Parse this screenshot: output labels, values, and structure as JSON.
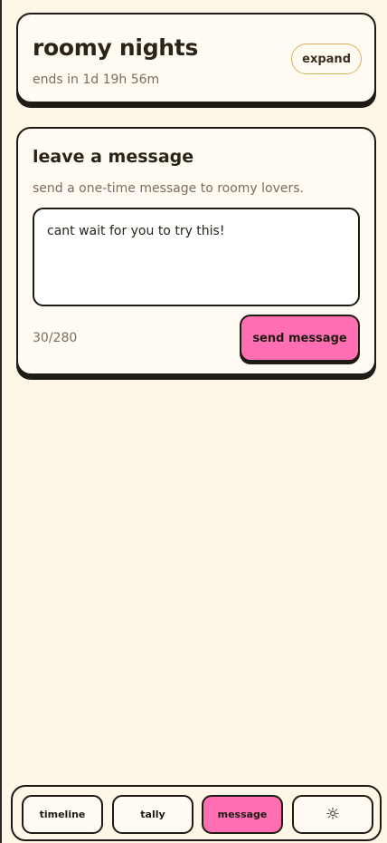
{
  "event": {
    "title": "roomy nights",
    "ends_text": "ends in 1d 19h 56m",
    "expand_label": "expand"
  },
  "message": {
    "title": "leave a message",
    "description": "send a one-time message to roomy lovers.",
    "input_value": "cant wait for you to try this!",
    "counter": "30/280",
    "send_label": "send message"
  },
  "tabs": {
    "timeline": "timeline",
    "tally": "tally",
    "message": "message",
    "settings_icon": "☼",
    "active": "message"
  },
  "colors": {
    "background": "#fef6e6",
    "card": "#fffbf2",
    "accent": "#ff6fb1",
    "border": "#1e1a14",
    "muted_text": "#7a6e5e"
  },
  "icons": {
    "settings": "sun-icon"
  }
}
